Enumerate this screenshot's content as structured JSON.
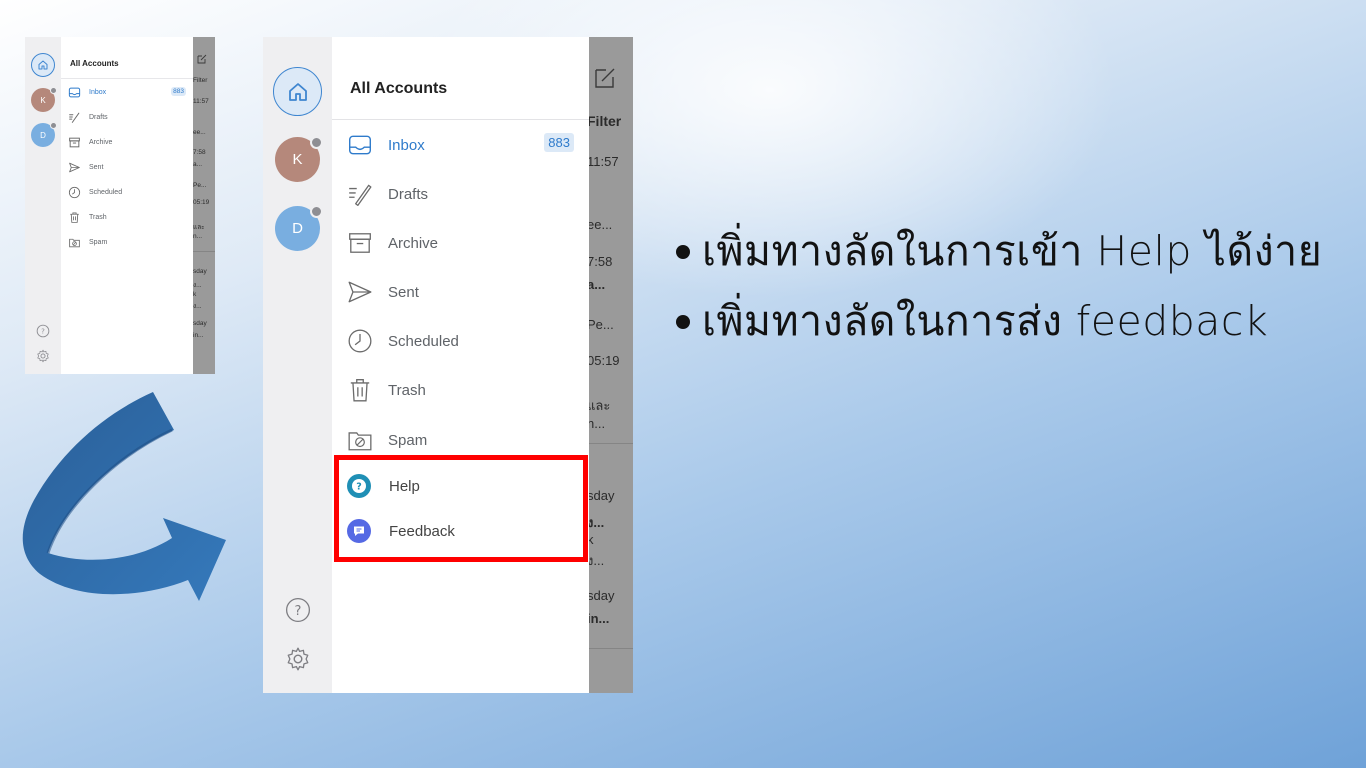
{
  "drawer": {
    "title": "All Accounts",
    "accounts": [
      {
        "initial": "K",
        "color": "#b5887b"
      },
      {
        "initial": "D",
        "color": "#79aee0"
      }
    ],
    "items": [
      {
        "label": "Inbox",
        "icon": "inbox-icon",
        "badge": "883",
        "active": true
      },
      {
        "label": "Drafts",
        "icon": "drafts-icon"
      },
      {
        "label": "Archive",
        "icon": "archive-icon"
      },
      {
        "label": "Sent",
        "icon": "sent-icon"
      },
      {
        "label": "Scheduled",
        "icon": "clock-icon"
      },
      {
        "label": "Trash",
        "icon": "trash-icon"
      },
      {
        "label": "Spam",
        "icon": "spam-icon"
      }
    ],
    "new_items": [
      {
        "label": "Help",
        "icon": "help-circle-icon",
        "color": "#1f8fb5"
      },
      {
        "label": "Feedback",
        "icon": "feedback-icon",
        "color": "#5569e4"
      }
    ]
  },
  "behind_list": {
    "big": [
      "Filter",
      "11:57",
      "ee...",
      "7:58",
      "a...",
      "Pe...",
      "05:19",
      "และ",
      "n...",
      "sday",
      "ง...",
      "k",
      "ง...",
      "sday",
      "in..."
    ],
    "small": [
      "Filter",
      "11:57",
      "ee...",
      "7:58",
      "a...",
      "Pe...",
      "05:19",
      "และ",
      "n...",
      "sday",
      "ง...",
      "k",
      "ง...",
      "sday",
      "in..."
    ]
  },
  "bullets": [
    "เพิ่มทางลัดในการเข้า Help ได้ง่าย",
    "เพิ่มทางลัดในการส่ง feedback"
  ],
  "colors": {
    "accent": "#2f7bcb",
    "highlight": "#ff0000",
    "arrow": "#2e6ca8"
  }
}
